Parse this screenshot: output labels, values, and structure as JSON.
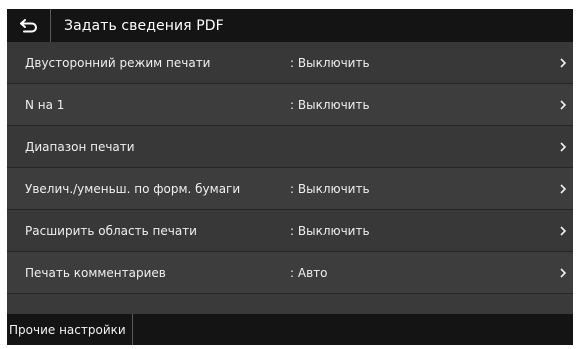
{
  "header": {
    "back_icon": "return-arrow-icon",
    "title": "Задать сведения PDF"
  },
  "rows": [
    {
      "label": "Двусторонний режим печати",
      "value": ": Выключить"
    },
    {
      "label": "N на 1",
      "value": ": Выключить"
    },
    {
      "label": "Диапазон печати",
      "value": ""
    },
    {
      "label": "Увелич./уменьш. по форм. бумаги",
      "value": ": Выключить"
    },
    {
      "label": "Расширить область печати",
      "value": ": Выключить"
    },
    {
      "label": "Печать комментариев",
      "value": ": Авто"
    }
  ],
  "footer": {
    "other_settings_label": "Прочие настройки"
  },
  "colors": {
    "header_bg": "#141414",
    "row_bg": "#3a3a3a",
    "text": "#f0f0f0"
  }
}
